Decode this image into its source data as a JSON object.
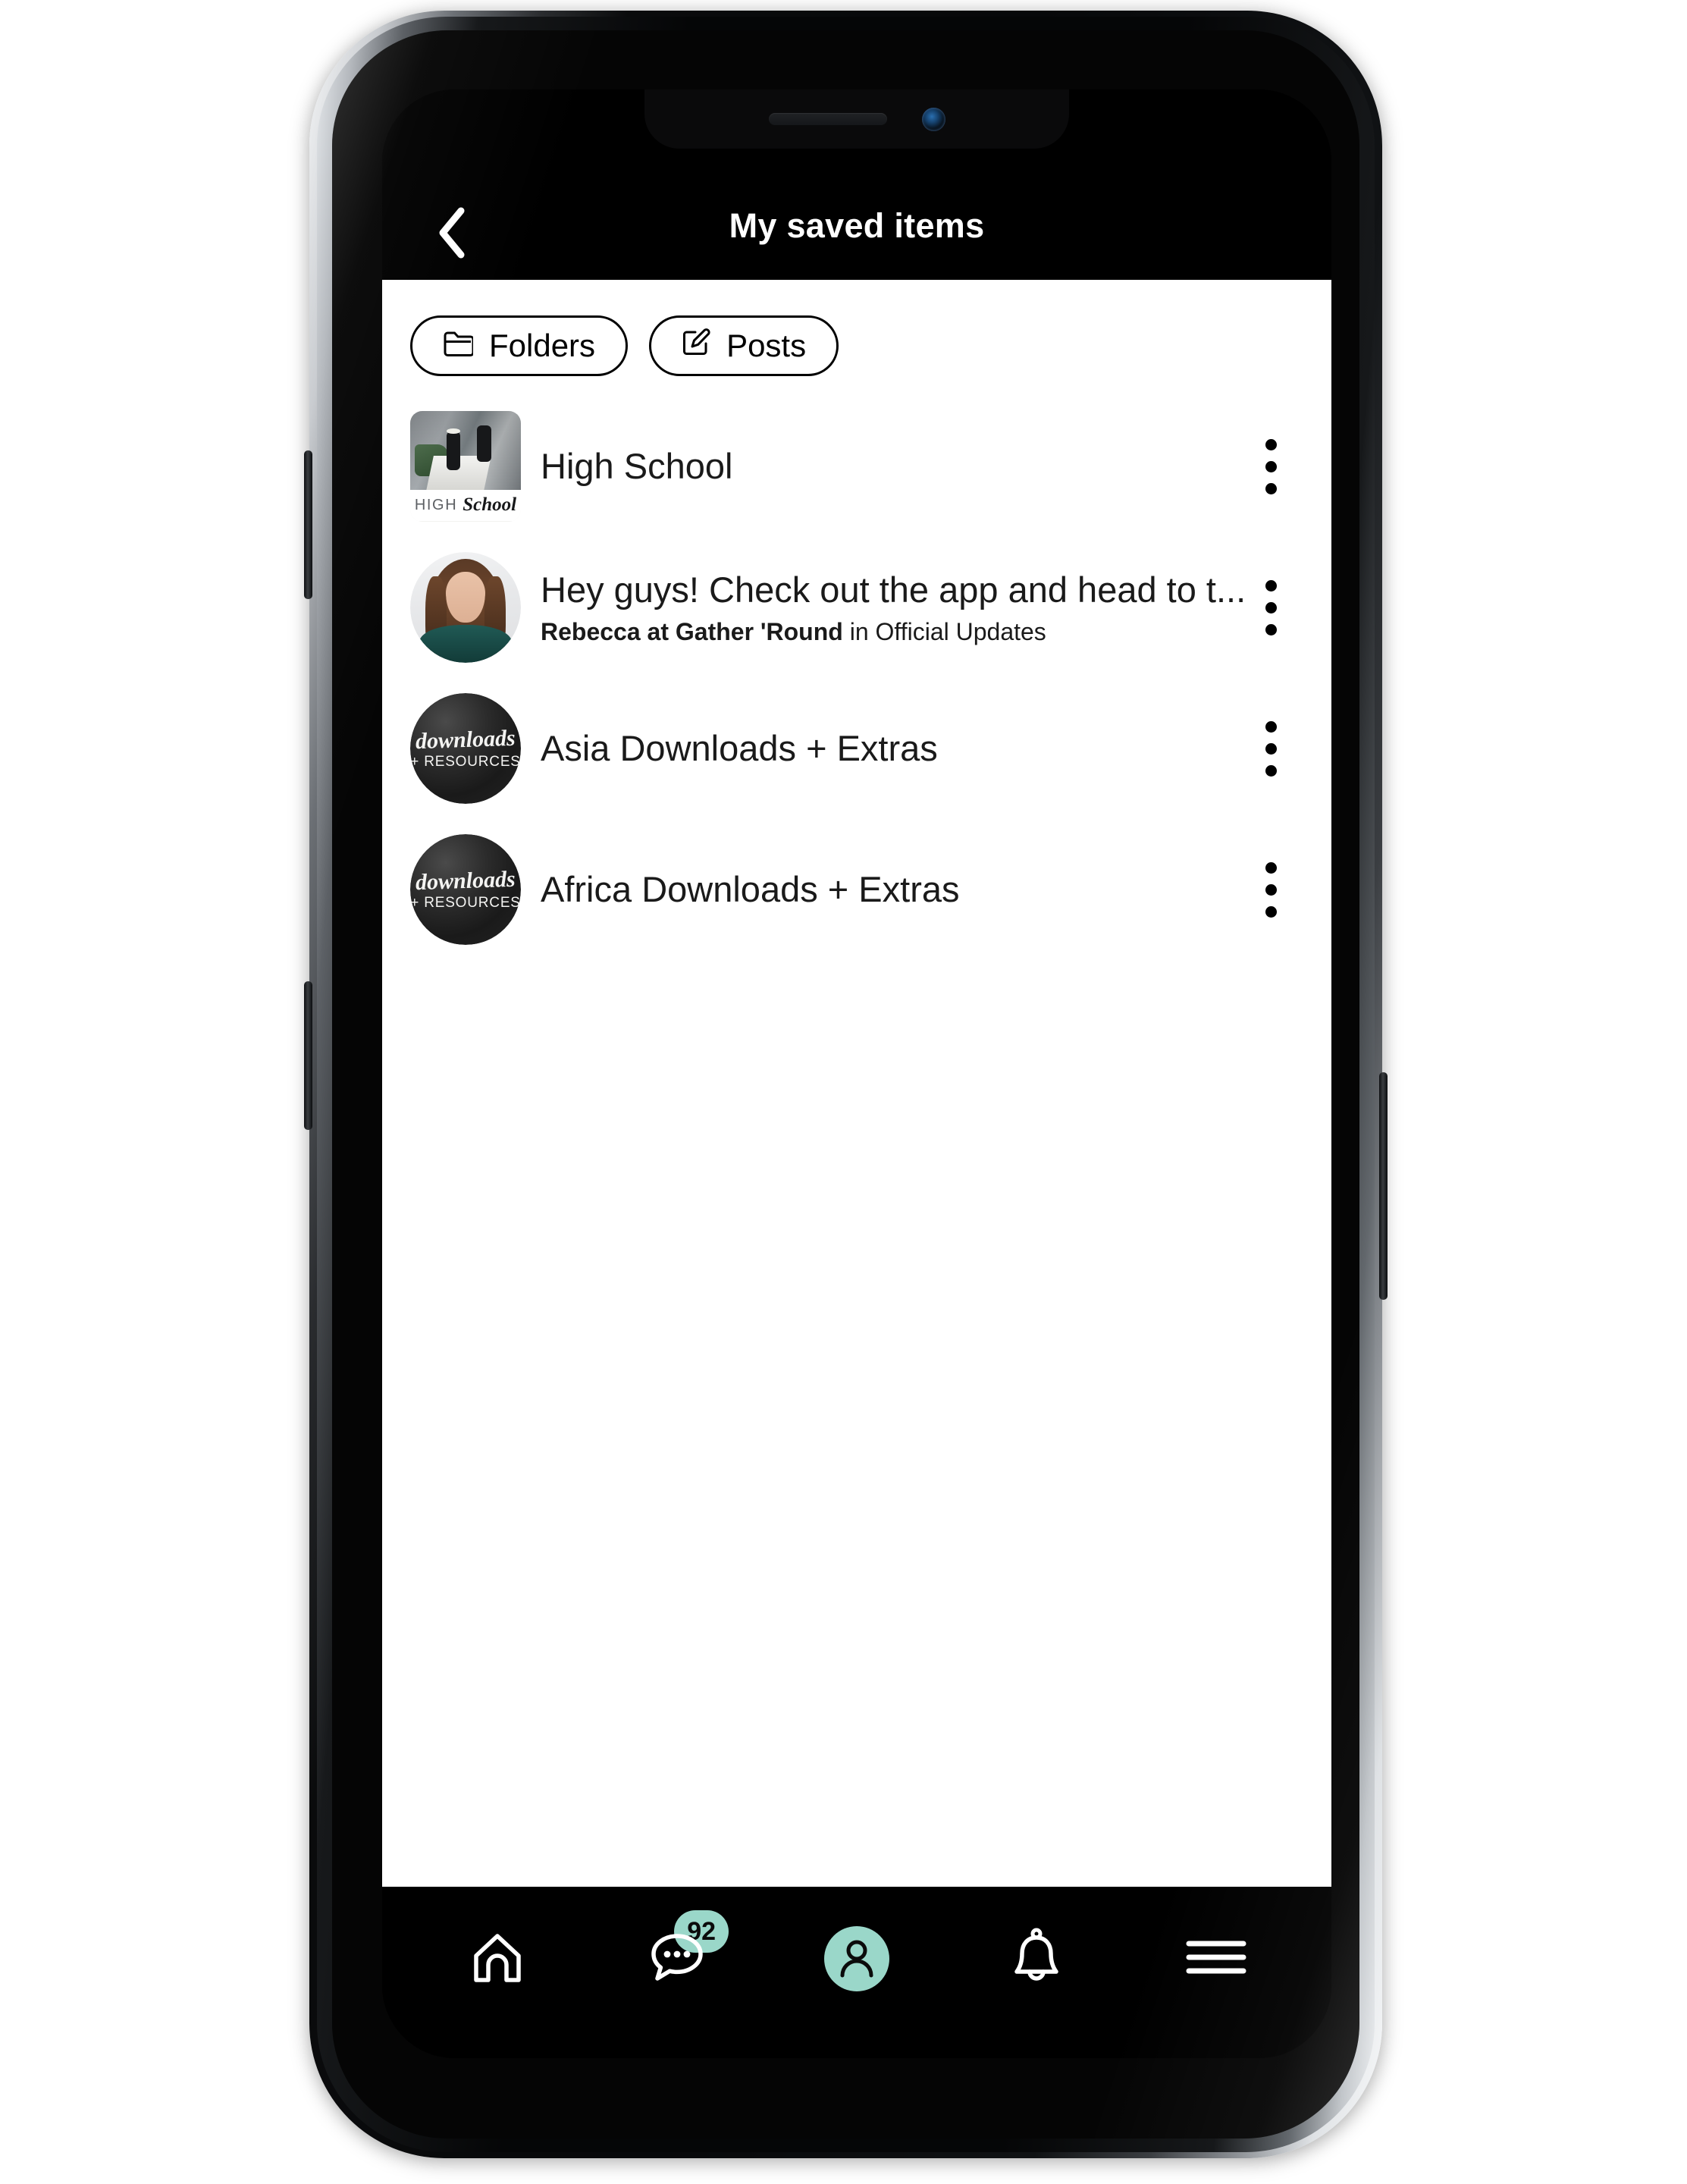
{
  "header": {
    "title": "My saved items",
    "back_icon": "chevron-left-icon"
  },
  "filters": [
    {
      "label": "Folders",
      "icon": "folder-icon"
    },
    {
      "label": "Posts",
      "icon": "edit-square-icon"
    }
  ],
  "list": [
    {
      "type": "folder",
      "title": "High School",
      "subtitle": "",
      "thumb": "high-school-cover-image",
      "menu_icon": "kebab-menu-icon"
    },
    {
      "type": "post",
      "title": "Hey guys! Check out the app and head to t...",
      "author": "Rebecca at Gather 'Round",
      "subtitle_tail": " in Official Updates",
      "thumb": "rebecca-avatar",
      "menu_icon": "kebab-menu-icon"
    },
    {
      "type": "folder",
      "title": "Asia Downloads + Extras",
      "subtitle": "",
      "thumb": "downloads-resources-logo",
      "menu_icon": "kebab-menu-icon"
    },
    {
      "type": "folder",
      "title": "Africa Downloads + Extras",
      "subtitle": "",
      "thumb": "downloads-resources-logo",
      "menu_icon": "kebab-menu-icon"
    }
  ],
  "thumb_art": {
    "high_school_word1": "HIGH",
    "high_school_word2": "School",
    "downloads_word1": "downloads",
    "downloads_word2": "+ RESOURCES"
  },
  "nav": [
    {
      "name": "home",
      "icon": "home-icon",
      "badge": "",
      "active": false
    },
    {
      "name": "messages",
      "icon": "chat-icon",
      "badge": "92",
      "active": false
    },
    {
      "name": "profile",
      "icon": "person-icon",
      "badge": "",
      "active": true
    },
    {
      "name": "notifications",
      "icon": "bell-icon",
      "badge": "",
      "active": false
    },
    {
      "name": "menu",
      "icon": "hamburger-icon",
      "badge": "",
      "active": false
    }
  ],
  "colors": {
    "accent": "#9ad7c9",
    "header_bg": "#000000",
    "body_bg": "#ffffff",
    "text": "#1a1a1a"
  }
}
